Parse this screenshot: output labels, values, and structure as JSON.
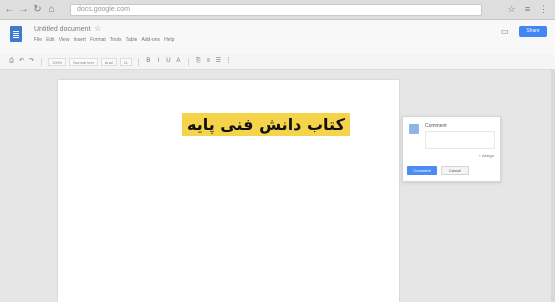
{
  "browser": {
    "nav_back": "←",
    "nav_forward": "→",
    "nav_reload": "↻",
    "nav_home": "⌂",
    "address": "docs.google.com",
    "right_icons": [
      "☆",
      "≡",
      "⋮"
    ]
  },
  "docs": {
    "title": "Untitled document",
    "star": "☆",
    "menu": [
      "File",
      "Edit",
      "View",
      "Insert",
      "Format",
      "Tools",
      "Table",
      "Add-ons",
      "Help"
    ],
    "comments_icon": "▭",
    "share_label": "Share"
  },
  "toolbar": {
    "zoom": "100%",
    "style": "Normal text",
    "font": "Arial",
    "size": "11",
    "icons": [
      "⎙",
      "↶",
      "↷",
      "B",
      "I",
      "U",
      "A",
      "⎘",
      "≡",
      "☰",
      "⋮"
    ]
  },
  "document": {
    "text": "کتاب دانش فنی پایه",
    "highlight_color": "#f5d44c"
  },
  "comment": {
    "author": "Comment",
    "assign": "+ Assign",
    "comment_button": "Comment",
    "cancel_button": "Cancel"
  }
}
